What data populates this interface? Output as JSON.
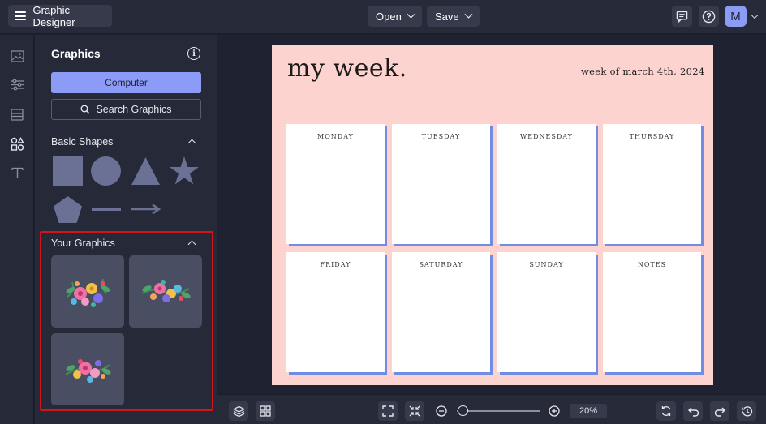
{
  "header": {
    "app_title": "Graphic Designer",
    "open_label": "Open",
    "save_label": "Save",
    "avatar_initial": "M",
    "icons": [
      "menu-icon",
      "comment-icon",
      "help-icon",
      "chevron-down-icon"
    ]
  },
  "rail": {
    "items": [
      "image-icon",
      "sliders-icon",
      "layout-icon",
      "shapes-icon",
      "text-icon"
    ]
  },
  "panel": {
    "title": "Graphics",
    "computer_label": "Computer",
    "search_label": "Search Graphics",
    "basic_shapes_title": "Basic Shapes",
    "your_graphics_title": "Your Graphics",
    "shapes": [
      "square",
      "circle",
      "triangle",
      "star",
      "pentagon",
      "line",
      "arrow"
    ]
  },
  "planner": {
    "title": "my week.",
    "subtitle": "week of march 4th, 2024",
    "days": [
      "MONDAY",
      "TUESDAY",
      "WEDNESDAY",
      "THURSDAY",
      "FRIDAY",
      "SATURDAY",
      "SUNDAY",
      "NOTES"
    ]
  },
  "footer": {
    "zoom_value": "20%",
    "zoom_fraction": 0.02
  },
  "colors": {
    "accent": "#8c9cf6",
    "planner_bg": "#fdd3d0",
    "card_shadow": "#6f8de4",
    "highlight": "#d4141c"
  }
}
